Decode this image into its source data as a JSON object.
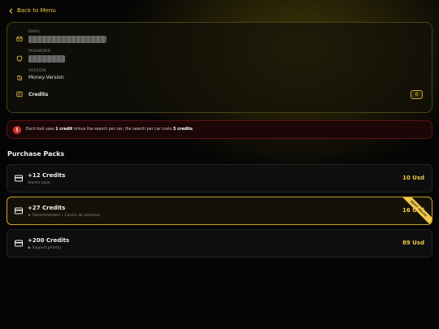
{
  "nav": {
    "back_label": "Back to Menu"
  },
  "account": {
    "email_label": "EMAIL",
    "password_label": "PASSWORD",
    "version_label": "VERSION",
    "version_value": "Money-Version",
    "credits_label": "Credits",
    "credits_value": "0"
  },
  "alert": {
    "icon": "!",
    "text_prefix": "Each tool uses ",
    "text_bold1": "1 credit",
    "text_middle": " minus the search per car, the search per car costs ",
    "text_bold2": "5 credits",
    "text_suffix": "."
  },
  "packs_title": "Purchase Packs",
  "packs": [
    {
      "title": "+12 Credits",
      "subtitle": "Starter pack",
      "price": "10 Usd"
    },
    {
      "title": "+27 Credits",
      "subtitle": "Recommended • Covers all searches",
      "price": "16 Usd",
      "ribbon": "BEST VALUE"
    },
    {
      "title": "+200 Credits",
      "subtitle": "Support priority",
      "price": "89 Usd"
    }
  ],
  "colors": {
    "accent": "#f2c94c",
    "alert": "#d32f2f",
    "support": "#3cc7e0"
  }
}
